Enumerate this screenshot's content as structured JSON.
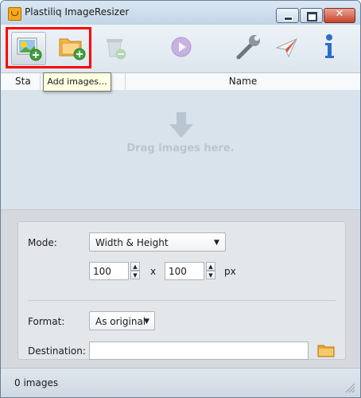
{
  "window": {
    "title": "Plastiliq ImageResizer",
    "controls": {
      "close_symbol": "✕"
    }
  },
  "toolbar": {
    "tools": [
      {
        "name": "add-images",
        "icon": "add-images-icon"
      },
      {
        "name": "add-folder",
        "icon": "add-folder-icon"
      },
      {
        "name": "remove",
        "icon": "remove-icon",
        "disabled": true
      },
      {
        "name": "start",
        "icon": "play-icon",
        "disabled": true
      },
      {
        "name": "settings",
        "icon": "wrench-icon"
      },
      {
        "name": "send",
        "icon": "paper-plane-icon"
      },
      {
        "name": "about",
        "icon": "info-icon"
      }
    ],
    "tooltip": "Add images..."
  },
  "list": {
    "columns": [
      "Sta ...",
      "Name"
    ],
    "empty_hint": "Drag images here."
  },
  "settings": {
    "mode_label": "Mode:",
    "mode_value": "Width & Height",
    "width_value": "100",
    "by_symbol": "x",
    "height_value": "100",
    "unit": "px",
    "format_label": "Format:",
    "format_value": "As original",
    "destination_label": "Destination:",
    "destination_value": ""
  },
  "status": {
    "text": "0 images"
  },
  "colors": {
    "highlight": "#ff0000",
    "tooltip_bg": "#ffffe1",
    "background": "#d9e3ec"
  }
}
